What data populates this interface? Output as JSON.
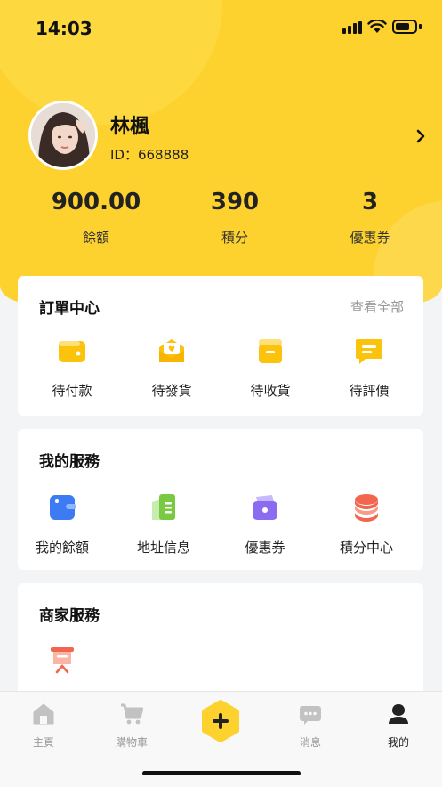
{
  "status_bar": {
    "time": "14:03"
  },
  "profile": {
    "name": "林楓",
    "id_text": "ID：668888"
  },
  "stats": [
    {
      "value": "900.00",
      "label": "餘額"
    },
    {
      "value": "390",
      "label": "積分"
    },
    {
      "value": "3",
      "label": "優惠券"
    }
  ],
  "orders": {
    "title": "訂單中心",
    "view_all": "查看全部",
    "items": [
      {
        "label": "待付款",
        "icon": "wallet-icon"
      },
      {
        "label": "待發貨",
        "icon": "package-heart-icon"
      },
      {
        "label": "待收貨",
        "icon": "box-icon"
      },
      {
        "label": "待評價",
        "icon": "comment-icon"
      }
    ]
  },
  "services": {
    "title": "我的服務",
    "items": [
      {
        "label": "我的餘額",
        "icon": "balance-card-icon"
      },
      {
        "label": "地址信息",
        "icon": "address-book-icon"
      },
      {
        "label": "優惠券",
        "icon": "coupon-wallet-icon"
      },
      {
        "label": "積分中心",
        "icon": "coin-stack-icon"
      }
    ]
  },
  "merchant": {
    "title": "商家服務",
    "items": [
      {
        "icon": "presentation-board-icon"
      }
    ]
  },
  "tabbar": {
    "items": [
      {
        "label": "主頁",
        "icon": "home-icon",
        "active": false
      },
      {
        "label": "購物車",
        "icon": "cart-icon",
        "active": false
      },
      {
        "label": "",
        "icon": "plus-icon",
        "active": false
      },
      {
        "label": "消息",
        "icon": "message-icon",
        "active": false
      },
      {
        "label": "我的",
        "icon": "user-icon",
        "active": true
      }
    ]
  },
  "colors": {
    "brand_yellow": "#fdd12e",
    "icon_yellow": "#fbc30b",
    "blue": "#3d7bf5",
    "green": "#7ac943",
    "purple": "#8b6cf0",
    "red": "#f2664f"
  }
}
